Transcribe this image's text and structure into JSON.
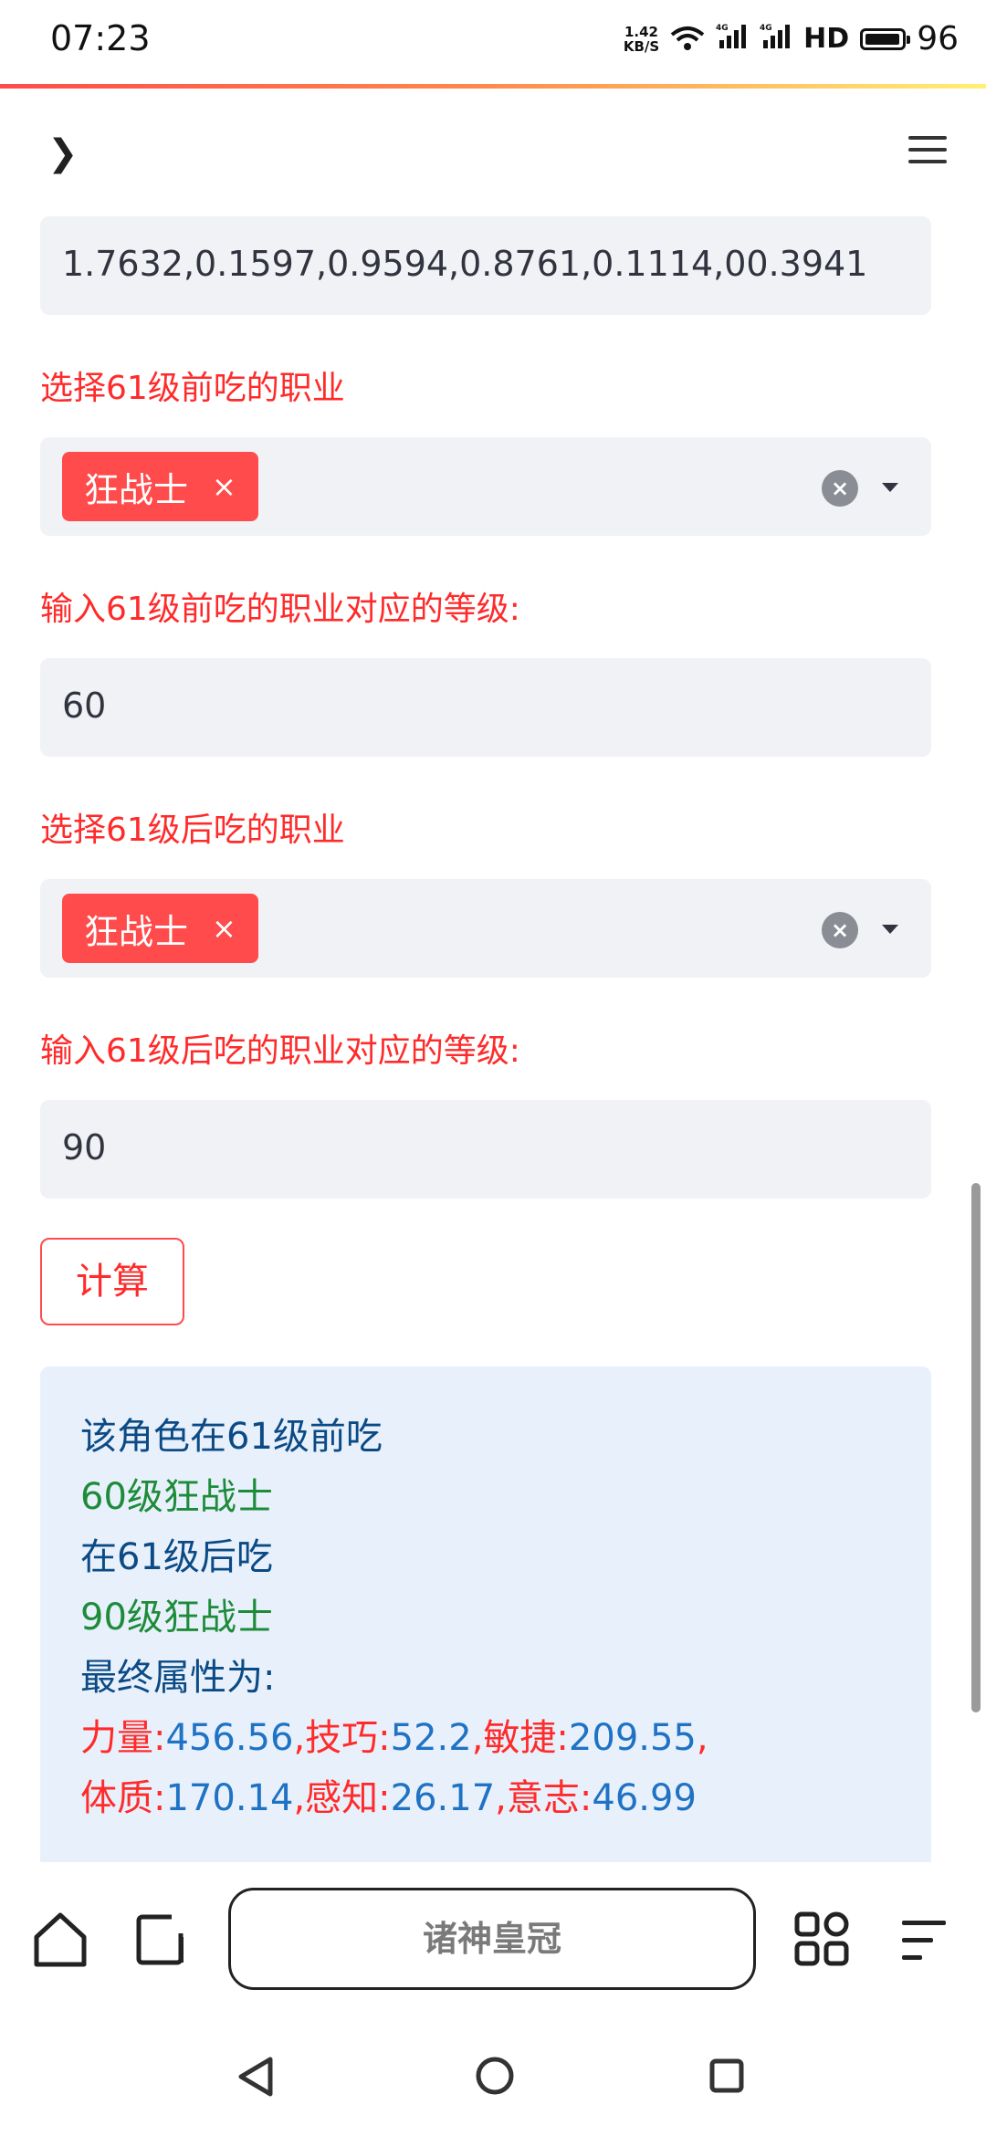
{
  "status_bar": {
    "time": "07:23",
    "net_speed_value": "1.42",
    "net_speed_unit": "KB/S",
    "network_1": "4G",
    "network_2": "4G",
    "hd_label": "HD",
    "battery_level": "96",
    "battery_fraction": 0.96
  },
  "form": {
    "coefficients_value": "1.7632,0.1597,0.9594,0.8761,0.1114,00.3941",
    "pre61_job_label": "选择61级前吃的职业",
    "pre61_job_tag": "狂战士",
    "pre61_level_label": "输入61级前吃的职业对应的等级:",
    "pre61_level_value": "60",
    "post61_job_label": "选择61级后吃的职业",
    "post61_job_tag": "狂战士",
    "post61_level_label": "输入61级后吃的职业对应的等级:",
    "post61_level_value": "90",
    "tag_remove": "×",
    "clear": "×",
    "calculate_label": "计算"
  },
  "result": {
    "line1": "该角色在61级前吃",
    "line2": "60级狂战士",
    "line3": "在61级后吃",
    "line4": "90级狂战士",
    "line5": "最终属性为:",
    "stats_row1": [
      {
        "name": "力量:",
        "value": "456.56",
        "sep": ","
      },
      {
        "name": "技巧:",
        "value": "52.2",
        "sep": ","
      },
      {
        "name": "敏捷:",
        "value": "209.55",
        "sep": ","
      }
    ],
    "stats_row2": [
      {
        "name": "体质:",
        "value": "170.14",
        "sep": ","
      },
      {
        "name": "感知:",
        "value": "26.17",
        "sep": ","
      },
      {
        "name": "意志:",
        "value": "46.99",
        "sep": ""
      }
    ]
  },
  "browser_bar": {
    "search_text": "诸神皇冠"
  },
  "colors": {
    "accent": "#ff4b4b",
    "label_red": "#ff2b2b",
    "result_bg": "#e8f1fb",
    "result_blue": "#0b4a85",
    "result_green": "#1e8b3a",
    "value_blue": "#1f72c4"
  }
}
